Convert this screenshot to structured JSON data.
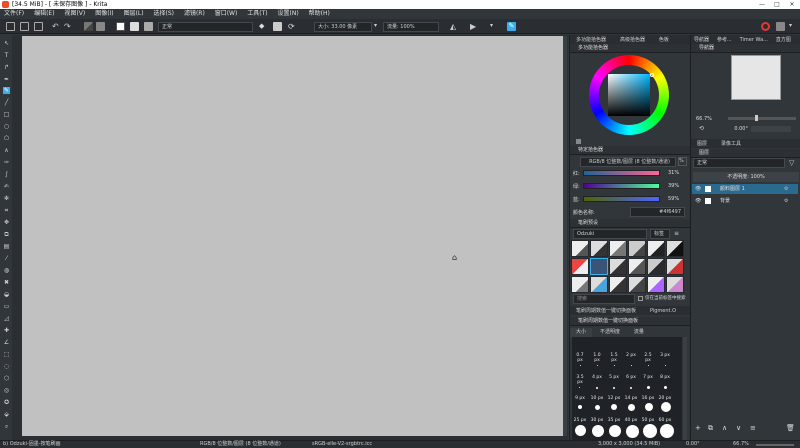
{
  "window": {
    "title": "[34.5 MiB] - [ 未保存图像 ] - Krita",
    "controls": [
      "—",
      "□",
      "✕"
    ]
  },
  "menu": [
    "文件(F)",
    "编辑(E)",
    "视图(V)",
    "图像(I)",
    "图层(L)",
    "选择(S)",
    "滤镜(R)",
    "窗口(W)",
    "工具(T)",
    "设置(N)",
    "帮助(H)"
  ],
  "toolbar": {
    "blend_mode": "正常",
    "size": "大小: 33.00 像素",
    "flow": "流量: 100%"
  },
  "color_panel": {
    "tabs": [
      "多功能拾色器",
      "高级拾色器",
      "色板"
    ],
    "title": "多功能拾色器"
  },
  "specific_selector": {
    "title": "特定拾色器",
    "colorspace": "RGB/8 位整数/图层 (8 位整数/通道)",
    "channels": [
      {
        "label": "红:",
        "value": "31%"
      },
      {
        "label": "绿:",
        "value": "39%"
      },
      {
        "label": "蓝:",
        "value": "59%"
      }
    ],
    "color_name_label": "颜色名称:",
    "hex": "#4f6497"
  },
  "brush_presets": {
    "title": "笔刷预设",
    "filter": "Odzuki",
    "tag_label": "标签",
    "search_placeholder": "搜索",
    "filter_option": "仅在当前标签中搜索"
  },
  "hud_bar": {
    "label": "笔刷周期数值一键切换面板",
    "pigment": "Pigment.O"
  },
  "hud_panel": {
    "title": "笔刷周期数值一键切换面板",
    "tabs": [
      "大小",
      "不透明度",
      "流量"
    ],
    "sizes": [
      [
        "0.7 px",
        "1.0 px",
        "1.5 px",
        "2 px",
        "2.5 px",
        "3 px"
      ],
      [
        "3.5 px",
        "4 px",
        "5 px",
        "6 px",
        "7 px",
        "8 px"
      ],
      [
        "9 px",
        "10 px",
        "12 px",
        "14 px",
        "16 px",
        "20 px"
      ],
      [
        "25 px",
        "30 px",
        "35 px",
        "40 px",
        "50 px",
        "60 px"
      ]
    ]
  },
  "navigator": {
    "tabs": [
      "导航器",
      "参考...",
      "Timer Wa...",
      "直方图"
    ],
    "title": "导航器",
    "zoom": "66.7%",
    "rotation": "0.00°"
  },
  "layers_panel": {
    "tabs": [
      "图层",
      "录像工具"
    ],
    "title": "图层",
    "blend": "正常",
    "opacity": "不透明度: 100%",
    "layers": [
      {
        "name": "颜料图层 1",
        "selected": true
      },
      {
        "name": "背景",
        "selected": false
      }
    ]
  },
  "status": {
    "brush": "b) Odzuki-固墨-按笔刷画",
    "colorspace": "RGB/8 位整数/图层 (8 位整数/通道)",
    "profile": "sRGB-elle-V2-srgbtrc.icc",
    "dims": "3,000 x 3,000 (34.5 MiB)",
    "rotation": "0.00°",
    "zoom": "66.7%"
  },
  "colors": {
    "accent": "#3daee9",
    "fg_color": "#4f6497"
  }
}
